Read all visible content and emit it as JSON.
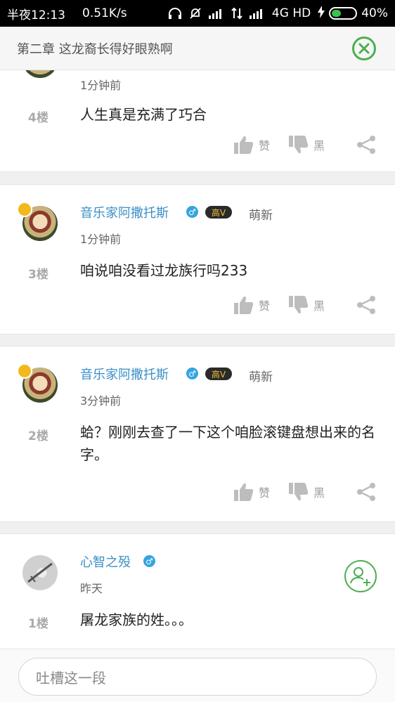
{
  "status_bar": {
    "time": "半夜12:13",
    "speed": "0.51K/s",
    "network": "4G HD",
    "battery": "40%",
    "battery_level": 0.4
  },
  "header": {
    "title": "第二章 这龙裔长得好眼熟啊"
  },
  "actions_labels": {
    "like": "赞",
    "dislike": "黑"
  },
  "comments": [
    {
      "time": "1分钟前",
      "floor": "4楼",
      "content": "人生真是充满了巧合"
    },
    {
      "user": "音乐家阿撒托斯",
      "gender": "♂",
      "vip": "高V",
      "level": "萌新",
      "time": "1分钟前",
      "floor": "3楼",
      "content": "咱说咱没看过龙族行吗233"
    },
    {
      "user": "音乐家阿撒托斯",
      "gender": "♂",
      "vip": "高V",
      "level": "萌新",
      "time": "3分钟前",
      "floor": "2楼",
      "content": "蛤？刚刚去查了一下这个咱脸滚键盘想出来的名字。"
    },
    {
      "user": "心智之殁",
      "gender": "♂",
      "time": "昨天",
      "floor": "1楼",
      "content": "屠龙家族的姓。。。"
    }
  ],
  "comment_bar": {
    "placeholder": "吐槽这一段"
  }
}
